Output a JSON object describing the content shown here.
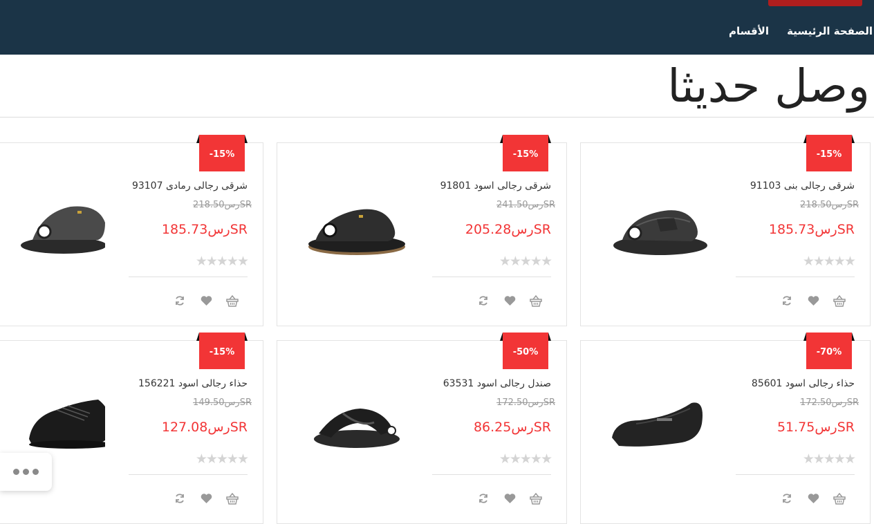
{
  "nav": {
    "home": "الصفحة الرئيسية",
    "categories": "الأقسام"
  },
  "page": {
    "title": "وصل حديثا"
  },
  "colors": {
    "header": "#1b3447",
    "accent": "#f23536"
  },
  "products": [
    {
      "name": "شرقى رجالى بنى 91103",
      "old_price": "رس218.50SR",
      "new_price": "رس185.73SR",
      "discount": "-15%",
      "rating": 0
    },
    {
      "name": "شرقى رجالى اسود 91801",
      "old_price": "رس241.50SR",
      "new_price": "رس205.28SR",
      "discount": "-15%",
      "rating": 0
    },
    {
      "name": "شرقى رجالى رمادى 93107",
      "old_price": "رس218.50SR",
      "new_price": "رس185.73SR",
      "discount": "-15%",
      "rating": 0
    },
    {
      "name": "حذاء رجالى اسود 85601",
      "old_price": "رس172.50SR",
      "new_price": "رس51.75SR",
      "discount": "-70%",
      "rating": 0
    },
    {
      "name": "صندل رجالى اسود 63531",
      "old_price": "رس172.50SR",
      "new_price": "رس86.25SR",
      "discount": "-50%",
      "rating": 0
    },
    {
      "name": "حذاء رجالى اسود 156221",
      "old_price": "رس149.50SR",
      "new_price": "رس127.08SR",
      "discount": "-15%",
      "rating": 0
    }
  ],
  "card_icons": [
    "cart-icon",
    "heart-icon",
    "refresh-icon"
  ],
  "stars_glyph": "★★★★★"
}
